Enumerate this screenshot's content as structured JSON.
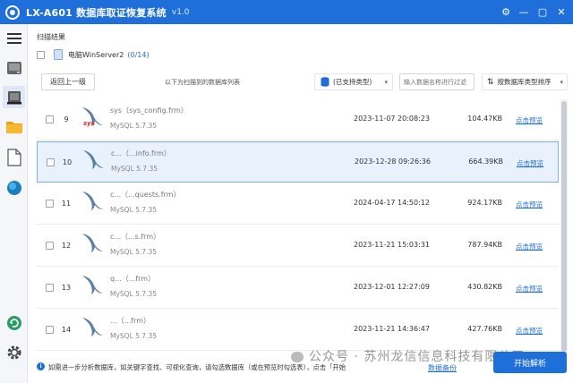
{
  "window": {
    "title": "LX-A601 数据库取证恢复系统",
    "version": "v1.0",
    "controls": {
      "settings": "⚙",
      "minimize": "—",
      "maximize": "▢",
      "close": "✕"
    }
  },
  "scan": {
    "label": "扫描结果",
    "source_name": "电脑WinServer2",
    "source_count": "(0/14)"
  },
  "toolbar": {
    "back_label": "返回上一级",
    "list_caption": "以下为扫描到的数据库列表",
    "type_select": "(已支持类型)",
    "search_placeholder": "输入数据名称进行过滤",
    "sort_select": "按数据库类型排序"
  },
  "rows": [
    {
      "num": "9",
      "name": "sys（sys_config.frm）",
      "db": "MySQL 5.7.35",
      "time": "2023-11-07 20:08:23",
      "size": "104.47KB",
      "link": "点击预览",
      "sys": "sys"
    },
    {
      "num": "10",
      "name": "c...（...info.frm）",
      "db": "MySQL 5.7.35",
      "time": "2023-12-28 09:26:36",
      "size": "664.39KB",
      "link": "点击预览",
      "sys": ""
    },
    {
      "num": "11",
      "name": "c...（...quests.frm）",
      "db": "MySQL 5.7.35",
      "time": "2024-04-17 14:50:12",
      "size": "924.17KB",
      "link": "点击预览",
      "sys": ""
    },
    {
      "num": "12",
      "name": "c...（...s.frm）",
      "db": "MySQL 5.7.35",
      "time": "2023-11-21 15:03:31",
      "size": "787.94KB",
      "link": "点击预览",
      "sys": ""
    },
    {
      "num": "13",
      "name": "q...（...frm）",
      "db": "MySQL 5.7.35",
      "time": "2023-12-01 12:27:09",
      "size": "430.82KB",
      "link": "点击预览",
      "sys": ""
    },
    {
      "num": "14",
      "name": "...（...frm）",
      "db": "MySQL 5.7.35",
      "time": "2023-11-21 14:36:47",
      "size": "427.76KB",
      "link": "点击预览",
      "sys": ""
    }
  ],
  "footer": {
    "hint": "如需进一步分析数据库，如关键字查找、可视化查询，请勾选数据库（或在预览时勾选表），点击「开始",
    "backup_link": "数据备份",
    "start_button": "开始解析"
  },
  "watermark": "公众号 · 苏州龙信信息科技有限公司",
  "colors": {
    "accent": "#1e6fd9",
    "selected_row": "#e8f1fc"
  }
}
